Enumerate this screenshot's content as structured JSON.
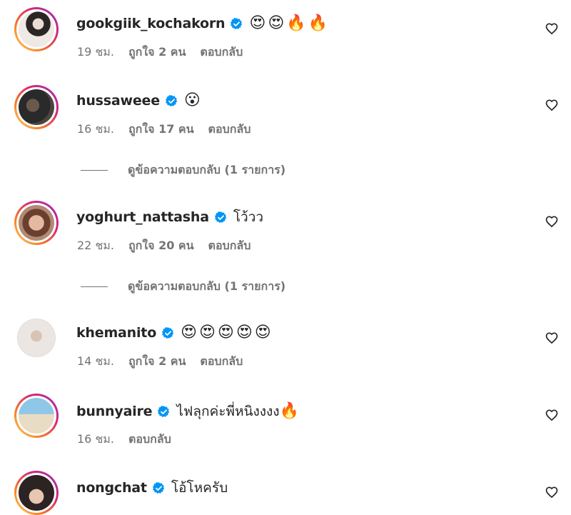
{
  "comments": [
    {
      "username": "gookgiik_kochakorn",
      "verified": true,
      "text": "",
      "emoji": [
        "😍",
        "😍",
        "🔥",
        "🔥"
      ],
      "time": "19 ชม.",
      "likes": "ถูกใจ 2 คน",
      "reply": "ตอบกลับ"
    },
    {
      "username": "hussaweee",
      "verified": true,
      "text": "",
      "emoji": [
        "😮"
      ],
      "time": "16 ชม.",
      "likes": "ถูกใจ 17 คน",
      "reply": "ตอบกลับ",
      "view_replies": "ดูข้อความตอบกลับ (1 รายการ)"
    },
    {
      "username": "yoghurt_nattasha",
      "verified": true,
      "text": "โว้วว",
      "emoji": [],
      "time": "22 ชม.",
      "likes": "ถูกใจ 20 คน",
      "reply": "ตอบกลับ",
      "view_replies": "ดูข้อความตอบกลับ (1 รายการ)"
    },
    {
      "username": "khemanito",
      "verified": true,
      "text": "",
      "emoji": [
        "😍",
        "😍",
        "😍",
        "😍",
        "😍"
      ],
      "time": "14 ชม.",
      "likes": "ถูกใจ 2 คน",
      "reply": "ตอบกลับ"
    },
    {
      "username": "bunnyaire",
      "verified": true,
      "text": "ไฟลุกค่ะพี่หนิงงงง",
      "emoji": [
        "🔥"
      ],
      "time": "16 ชม.",
      "likes": "",
      "reply": "ตอบกลับ"
    },
    {
      "username": "nongchat",
      "verified": true,
      "text": "โอ้โหครับ",
      "emoji": [],
      "time": "",
      "likes": "",
      "reply": ""
    }
  ],
  "colors": {
    "verified": "#0095f6",
    "muted": "#737373",
    "text": "#262626"
  },
  "icons": {
    "like": "heart-outline-icon",
    "verified": "verified-badge-icon"
  }
}
